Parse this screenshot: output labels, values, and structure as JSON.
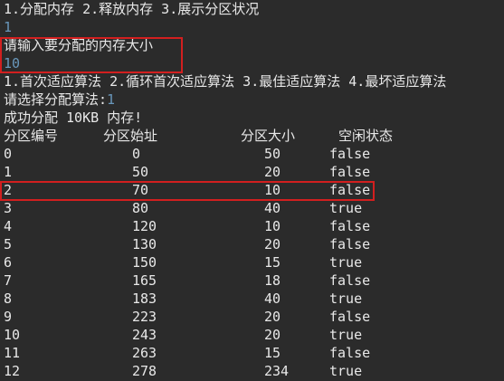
{
  "console": {
    "menu_line": "1.分配内存 2.释放内存 3.展示分区状况",
    "menu_choice": "1",
    "size_prompt": "请输入要分配的内存大小",
    "size_input": "10",
    "algo_menu": "1.首次适应算法 2.循环首次适应算法 3.最佳适应算法 4.最坏适应算法",
    "algo_prompt": "请选择分配算法:",
    "algo_choice": "1",
    "success_msg": "成功分配 10KB 内存!",
    "table": {
      "headers": [
        "分区编号",
        "分区始址",
        "分区大小",
        "空闲状态"
      ],
      "rows": [
        [
          "0",
          "0",
          "50",
          "false"
        ],
        [
          "1",
          "50",
          "20",
          "false"
        ],
        [
          "2",
          "70",
          "10",
          "false"
        ],
        [
          "3",
          "80",
          "40",
          "true"
        ],
        [
          "4",
          "120",
          "10",
          "false"
        ],
        [
          "5",
          "130",
          "20",
          "false"
        ],
        [
          "6",
          "150",
          "15",
          "true"
        ],
        [
          "7",
          "165",
          "18",
          "false"
        ],
        [
          "8",
          "183",
          "40",
          "true"
        ],
        [
          "9",
          "223",
          "20",
          "false"
        ],
        [
          "10",
          "243",
          "20",
          "true"
        ],
        [
          "11",
          "263",
          "15",
          "false"
        ],
        [
          "12",
          "278",
          "234",
          "true"
        ]
      ]
    }
  },
  "colors": {
    "background": "#2b2b2b",
    "text": "#e8e8e8",
    "user_input": "#6897bb",
    "highlight_border": "#d21f1f"
  }
}
